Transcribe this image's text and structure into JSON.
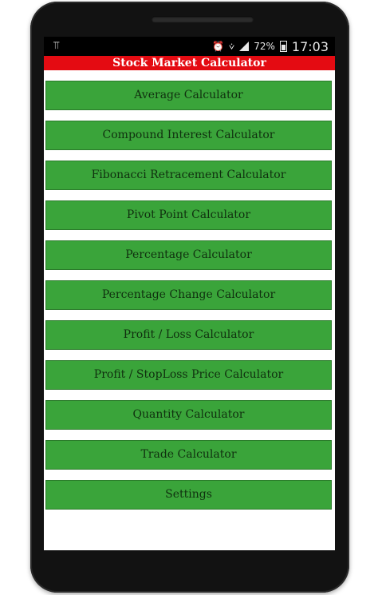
{
  "status_bar": {
    "usb_icon": "usb-icon",
    "battery_percent": "72%",
    "time": "17:03"
  },
  "app": {
    "title": "Stock Market Calculator"
  },
  "menu": {
    "items": [
      {
        "label": "Average Calculator"
      },
      {
        "label": "Compound Interest Calculator"
      },
      {
        "label": "Fibonacci Retracement Calculator"
      },
      {
        "label": "Pivot Point Calculator"
      },
      {
        "label": "Percentage Calculator"
      },
      {
        "label": "Percentage Change Calculator"
      },
      {
        "label": "Profit / Loss Calculator"
      },
      {
        "label": "Profit / StopLoss Price Calculator"
      },
      {
        "label": "Quantity Calculator"
      },
      {
        "label": "Trade Calculator"
      },
      {
        "label": "Settings"
      }
    ]
  },
  "colors": {
    "title_bg": "#e40b12",
    "button_bg": "#3aa43a",
    "button_text": "#10300f"
  }
}
